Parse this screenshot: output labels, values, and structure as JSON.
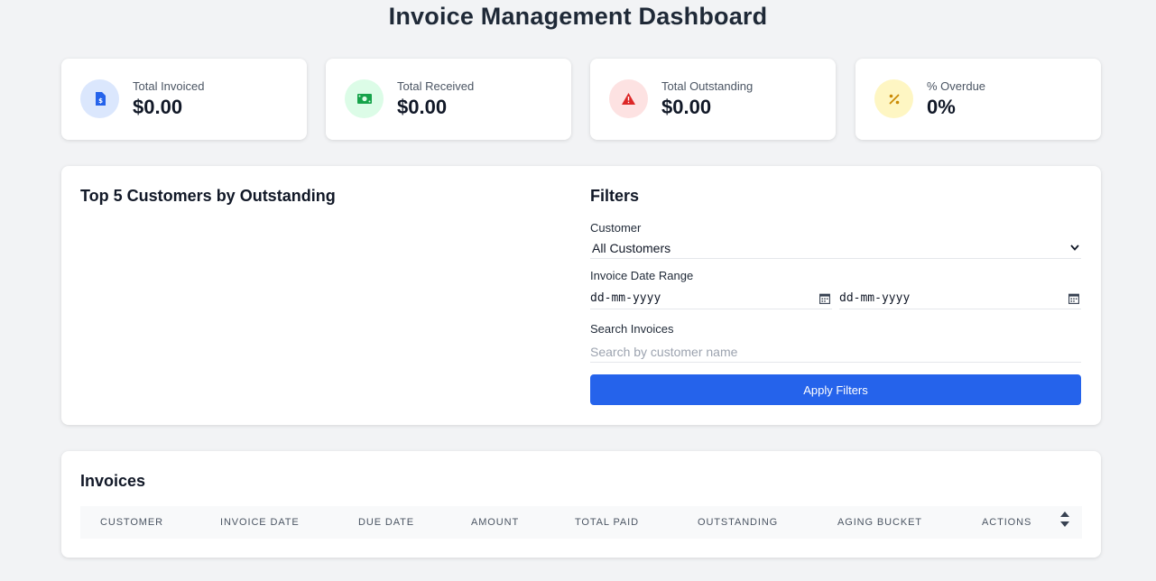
{
  "page": {
    "title": "Invoice Management Dashboard"
  },
  "stats": [
    {
      "label": "Total Invoiced",
      "value": "$0.00",
      "icon": "invoice-dollar-icon",
      "bg": "#dbe7fd",
      "fg": "#2563eb"
    },
    {
      "label": "Total Received",
      "value": "$0.00",
      "icon": "money-bill-icon",
      "bg": "#dcfce7",
      "fg": "#16a34a"
    },
    {
      "label": "Total Outstanding",
      "value": "$0.00",
      "icon": "warning-triangle-icon",
      "bg": "#fde2e2",
      "fg": "#dc2626"
    },
    {
      "label": "% Overdue",
      "value": "0%",
      "icon": "percent-icon",
      "bg": "#fef6c3",
      "fg": "#ca8a04"
    }
  ],
  "chart_section": {
    "title": "Top 5 Customers by Outstanding"
  },
  "filters": {
    "title": "Filters",
    "customer_label": "Customer",
    "customer_value": "All Customers",
    "date_range_label": "Invoice Date Range",
    "date_from": "dd-mm-yyyy",
    "date_to": "dd-mm-yyyy",
    "search_label": "Search Invoices",
    "search_placeholder": "Search by customer name",
    "apply_label": "Apply Filters"
  },
  "invoices": {
    "title": "Invoices",
    "columns": [
      "CUSTOMER",
      "INVOICE DATE",
      "DUE DATE",
      "AMOUNT",
      "TOTAL PAID",
      "OUTSTANDING",
      "AGING BUCKET",
      "ACTIONS"
    ],
    "rows": []
  },
  "colors": {
    "accent": "#2563eb",
    "background": "#f2f3f5"
  }
}
